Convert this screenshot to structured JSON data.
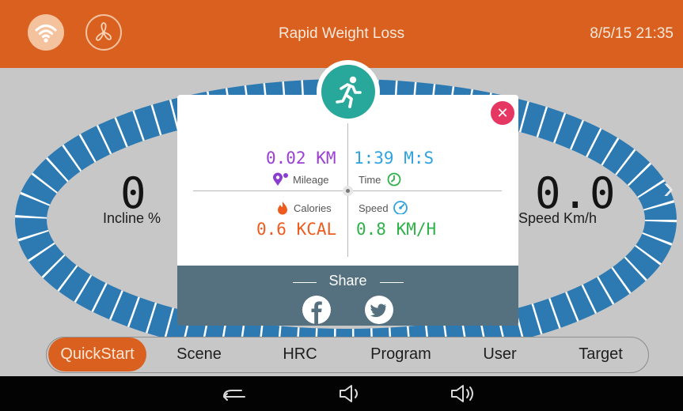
{
  "header": {
    "title": "Rapid Weight Loss",
    "datetime": "8/5/15 21:35",
    "wifi_icon": "wifi-icon",
    "fan_icon": "fan-icon",
    "accent_color": "#d9601f"
  },
  "dashboard": {
    "incline_value": "0",
    "incline_label": "Incline %",
    "speed_value": "0.0",
    "speed_label": "Speed Km/h"
  },
  "summary": {
    "badge_icon": "runner-icon",
    "mileage_value": "0.02 KM",
    "mileage_label": "Mileage",
    "time_value": "1:39 M:S",
    "time_label": "Time",
    "calories_value": "0.6 KCAL",
    "calories_label": "Calories",
    "speed_value": "0.8 KM/H",
    "speed_label": "Speed",
    "share_label": "Share",
    "colors": {
      "mileage": "#9b3fd6",
      "time": "#2fa3e0",
      "calories": "#ef5b1f",
      "speed": "#2fb14a",
      "close": "#e63662",
      "badge": "#27a89a"
    }
  },
  "tabs": {
    "items": [
      "QuickStart",
      "Scene",
      "HRC",
      "Program",
      "User",
      "Target"
    ],
    "active": "QuickStart"
  },
  "navbar": {
    "icons": [
      "back-icon",
      "volume-down-icon",
      "volume-up-icon"
    ]
  }
}
